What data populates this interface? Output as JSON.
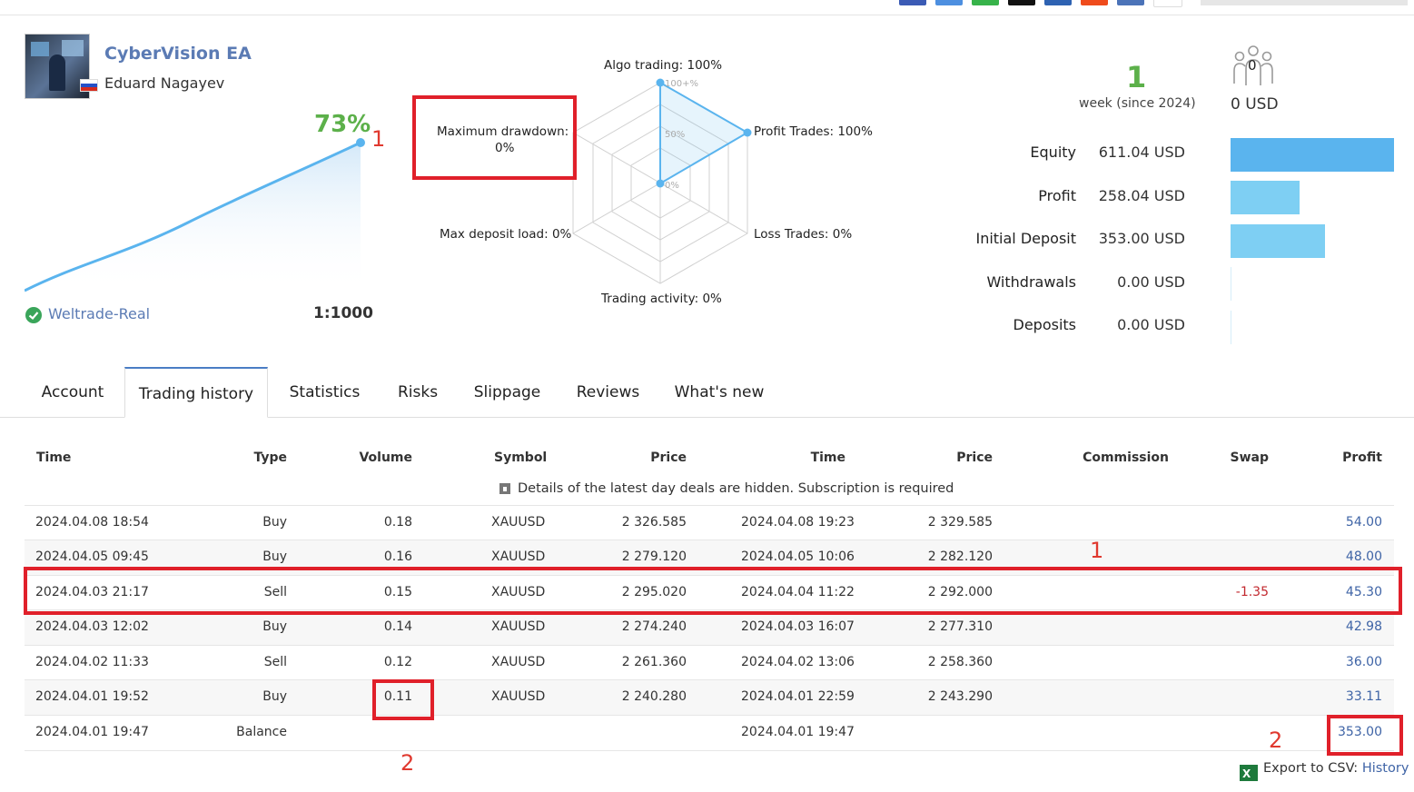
{
  "header": {
    "ea_name": "CyberVision EA",
    "author": "Eduard Nagayev",
    "growth_percent": "73%",
    "account_server": "Weltrade-Real",
    "leverage": "1:1000",
    "annotation_1": "1"
  },
  "radar": {
    "algo_trading": "Algo trading: 100%",
    "profit_trades": "Profit Trades: 100%",
    "loss_trades": "Loss Trades: 0%",
    "trading_activity": "Trading activity: 0%",
    "max_deposit_load": "Max deposit load: 0%",
    "max_drawdown_label": "Maximum drawdown:",
    "max_drawdown_value": "0%",
    "scale_100": "100+%",
    "scale_50": "50%",
    "scale_0": "0%"
  },
  "summary": {
    "weeks": "1",
    "weeks_label": "week (since 2024)",
    "subscribers_badge": "0",
    "subscription_value": "0 USD",
    "stats": [
      {
        "label": "Equity",
        "value": "611.04 USD",
        "fraction": 1.0
      },
      {
        "label": "Profit",
        "value": "258.04 USD",
        "fraction": 0.42
      },
      {
        "label": "Initial Deposit",
        "value": "353.00 USD",
        "fraction": 0.58
      },
      {
        "label": "Withdrawals",
        "value": "0.00 USD",
        "fraction": 0
      },
      {
        "label": "Deposits",
        "value": "0.00 USD",
        "fraction": 0
      }
    ]
  },
  "tabs": [
    "Account",
    "Trading history",
    "Statistics",
    "Risks",
    "Slippage",
    "Reviews",
    "What's new"
  ],
  "table": {
    "headers": [
      "Time",
      "Type",
      "Volume",
      "Symbol",
      "Price",
      "Time",
      "Price",
      "Commission",
      "Swap",
      "Profit"
    ],
    "hidden_note": "Details of the latest day deals are hidden. Subscription is required",
    "rows": [
      [
        "2024.04.08 18:54",
        "Buy",
        "0.18",
        "XAUUSD",
        "2 326.585",
        "2024.04.08 19:23",
        "2 329.585",
        "",
        "",
        "54.00"
      ],
      [
        "2024.04.05 09:45",
        "Buy",
        "0.16",
        "XAUUSD",
        "2 279.120",
        "2024.04.05 10:06",
        "2 282.120",
        "",
        "",
        "48.00"
      ],
      [
        "2024.04.03 21:17",
        "Sell",
        "0.15",
        "XAUUSD",
        "2 295.020",
        "2024.04.04 11:22",
        "2 292.000",
        "",
        "-1.35",
        "45.30"
      ],
      [
        "2024.04.03 12:02",
        "Buy",
        "0.14",
        "XAUUSD",
        "2 274.240",
        "2024.04.03 16:07",
        "2 277.310",
        "",
        "",
        "42.98"
      ],
      [
        "2024.04.02 11:33",
        "Sell",
        "0.12",
        "XAUUSD",
        "2 261.360",
        "2024.04.02 13:06",
        "2 258.360",
        "",
        "",
        "36.00"
      ],
      [
        "2024.04.01 19:52",
        "Buy",
        "0.11",
        "XAUUSD",
        "2 240.280",
        "2024.04.01 22:59",
        "2 243.290",
        "",
        "",
        "33.11"
      ],
      [
        "2024.04.01 19:47",
        "Balance",
        "",
        "",
        "",
        "2024.04.01 19:47",
        "",
        "",
        "",
        "353.00"
      ]
    ],
    "annotation_1": "1",
    "annotation_2": "2",
    "annotation_2b": "2"
  },
  "export": {
    "label": "Export to CSV:",
    "link": "History"
  },
  "colors": {
    "accent_blue": "#4a7dc4",
    "growth_green": "#5cb04a",
    "highlight_red": "#e0202a",
    "bar_equity": "#5ab4ee",
    "bar_light": "#7ecff3"
  }
}
